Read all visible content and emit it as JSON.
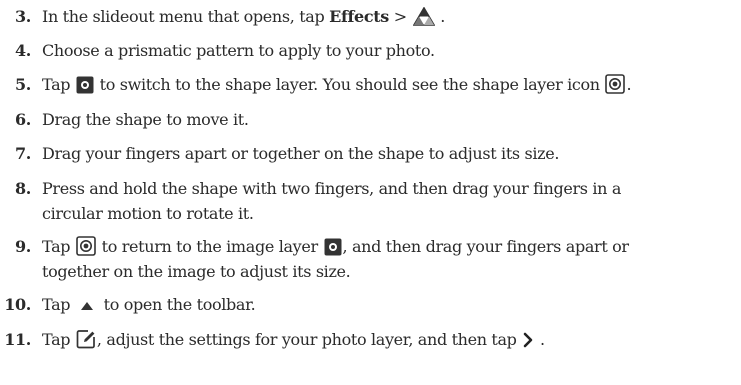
{
  "steps": [
    {
      "number": "3.",
      "parts": {
        "a": "In the slideout menu that opens, tap ",
        "b": "Effects",
        "c": " > ",
        "d": " ."
      }
    },
    {
      "number": "4.",
      "text": "Choose a prismatic pattern to apply to your photo."
    },
    {
      "number": "5.",
      "parts": {
        "a": "Tap ",
        "b": " to switch to the shape layer. You should see the shape layer icon ",
        "c": "."
      }
    },
    {
      "number": "6.",
      "text": "Drag the shape to move it."
    },
    {
      "number": "7.",
      "text": "Drag your fingers apart or together on the shape to adjust its size."
    },
    {
      "number": "8.",
      "line1": "Press and hold the shape with two fingers, and then drag your fingers in a",
      "line2": "circular motion to rotate it."
    },
    {
      "number": "9.",
      "parts": {
        "a": "Tap ",
        "b": " to return to the image layer ",
        "c": ", and then drag your fingers apart or"
      },
      "line2": "together on the image to adjust its size."
    },
    {
      "number": "10.",
      "parts": {
        "a": "Tap ",
        "b": " to open the toolbar."
      }
    },
    {
      "number": "11.",
      "parts": {
        "a": "Tap ",
        "b": ", adjust the settings for your photo layer, and then tap ",
        "c": " ."
      }
    }
  ],
  "icons": {
    "effects": "prism-triangle-icon",
    "image_layer": "image-layer-icon",
    "shape_layer": "shape-layer-icon",
    "toolbar": "up-triangle-icon",
    "edit": "edit-icon",
    "next": "chevron-right-icon"
  },
  "colors": {
    "text": "#2b2b2b",
    "icon": "#333333"
  }
}
